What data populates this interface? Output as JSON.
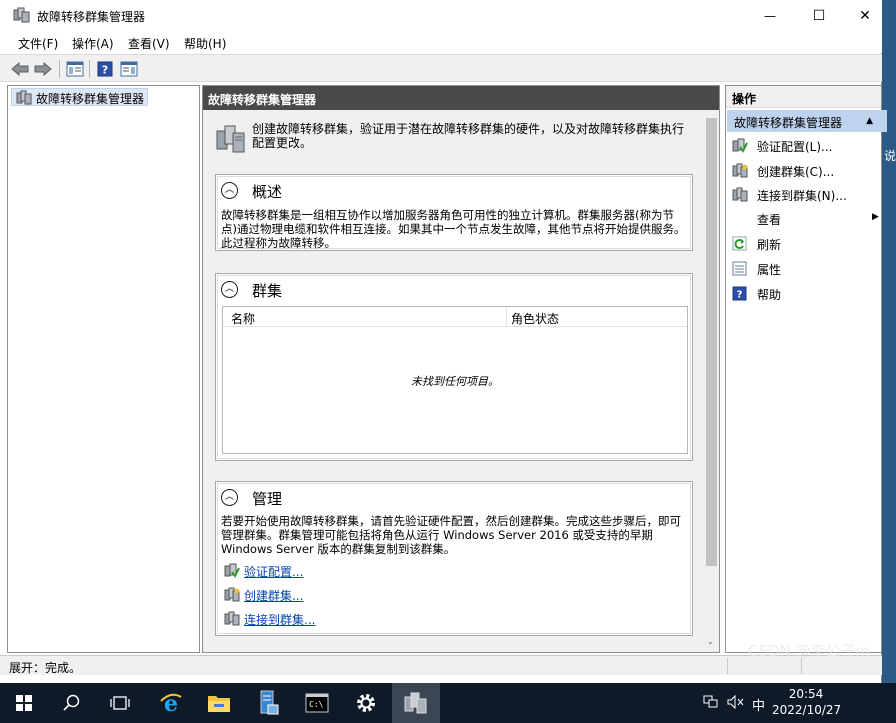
{
  "window": {
    "title": "故障转移群集管理器",
    "minimize_glyph": "—",
    "maximize_glyph": "☐",
    "close_glyph": "✕"
  },
  "menu": [
    "文件(F)",
    "操作(A)",
    "查看(V)",
    "帮助(H)"
  ],
  "toolbar": {
    "icons": [
      "back-arrow-icon",
      "forward-arrow-icon",
      "show-hide-console-tree-icon",
      "help-icon",
      "show-hide-action-pane-icon"
    ]
  },
  "tree": {
    "root_label": "故障转移群集管理器"
  },
  "center": {
    "header": "故障转移群集管理器",
    "intro": "创建故障转移群集，验证用于潜在故障转移群集的硬件，以及对故障转移群集执行配置更改。",
    "overview": {
      "title": "概述",
      "text": "故障转移群集是一组相互协作以增加服务器角色可用性的独立计算机。群集服务器(称为节点)通过物理电缆和软件相互连接。如果其中一个节点发生故障，其他节点将开始提供服务。此过程称为故障转移。"
    },
    "clusters": {
      "title": "群集",
      "columns": [
        "名称",
        "角色状态"
      ],
      "empty_text": "未找到任何项目。"
    },
    "management": {
      "title": "管理",
      "text": "若要开始使用故障转移群集，请首先验证硬件配置，然后创建群集。完成这些步骤后，即可管理群集。群集管理可能包括将角色从运行 Windows Server 2016 或受支持的早期 Windows Server 版本的群集复制到该群集。",
      "links": [
        "验证配置...",
        "创建群集...",
        "连接到群集..."
      ]
    }
  },
  "actions": {
    "header": "操作",
    "section": "故障转移群集管理器",
    "items": [
      {
        "label": "验证配置(L)...",
        "icon": "validate-config-icon"
      },
      {
        "label": "创建群集(C)...",
        "icon": "create-cluster-icon"
      },
      {
        "label": "连接到群集(N)...",
        "icon": "connect-cluster-icon"
      },
      {
        "label": "查看",
        "icon": "none"
      },
      {
        "label": "刷新",
        "icon": "refresh-icon"
      },
      {
        "label": "属性",
        "icon": "properties-icon"
      },
      {
        "label": "帮助",
        "icon": "help-icon"
      }
    ]
  },
  "status": {
    "text": "展开：完成。"
  },
  "desktop": {
    "edge_glyph": "说"
  },
  "taskbar": {
    "icons": [
      "windows-start-icon",
      "search-icon",
      "task-view-icon",
      "internet-explorer-icon",
      "file-explorer-icon",
      "server-manager-icon",
      "command-prompt-icon",
      "settings-gear-icon",
      "failover-cluster-manager-icon"
    ],
    "tray_ime": "中",
    "time": "20:54",
    "date": "2022/10/27",
    "watermark": "CSDN @李公子m"
  }
}
